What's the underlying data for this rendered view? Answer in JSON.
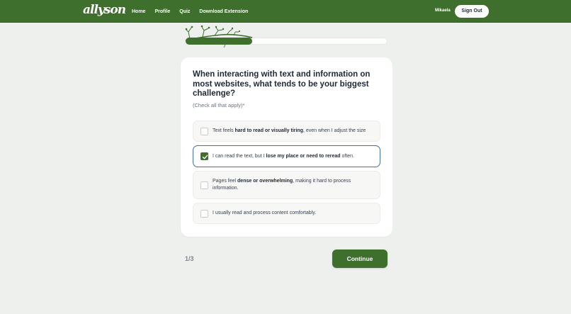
{
  "nav": {
    "logo": "allyson",
    "links": [
      "Home",
      "Profile",
      "Quiz",
      "Download Extension"
    ],
    "user": "Mikaela",
    "sign_out": "Sign Out"
  },
  "progress": {
    "fraction": 0.33
  },
  "question": {
    "text": "When interacting with text and information on most websites, what tends to be your biggest challenge?",
    "hint": "(Check all that apply)*"
  },
  "options": [
    {
      "parts": [
        {
          "t": "Text feels ",
          "b": false
        },
        {
          "t": "hard to read or visually tiring",
          "b": true
        },
        {
          "t": ", even when I adjust the size",
          "b": false
        }
      ],
      "checked": false
    },
    {
      "parts": [
        {
          "t": "I can read the text, but I ",
          "b": false
        },
        {
          "t": "lose my place or need to reread",
          "b": true
        },
        {
          "t": " often.",
          "b": false
        }
      ],
      "checked": true
    },
    {
      "parts": [
        {
          "t": "Pages feel ",
          "b": false
        },
        {
          "t": "dense or overwhelming",
          "b": true
        },
        {
          "t": ", making it hard to process information.",
          "b": false
        }
      ],
      "checked": false
    },
    {
      "parts": [
        {
          "t": "I usually read and process content comfortably.",
          "b": false
        }
      ],
      "checked": false
    }
  ],
  "footer": {
    "step": "1/3",
    "continue": "Continue"
  },
  "colors": {
    "brand_green": "#3e6f2d",
    "selected_border": "#3f6fa8"
  }
}
